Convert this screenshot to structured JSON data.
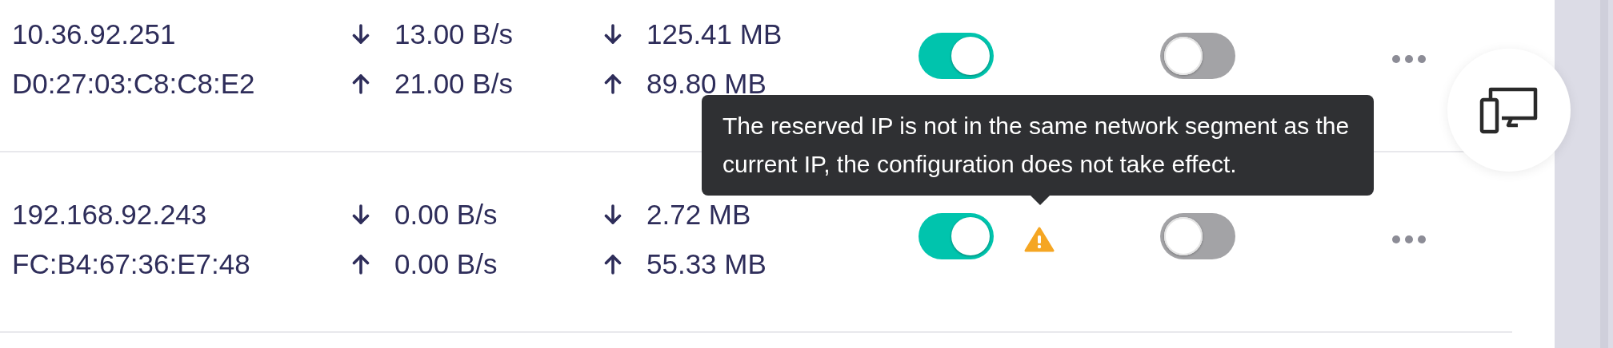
{
  "devices": [
    {
      "ip": "10.36.92.251",
      "mac": "D0:27:03:C8:C8:E2",
      "rate_down": "13.00 B/s",
      "rate_up": "21.00 B/s",
      "total_down": "125.41 MB",
      "total_up": "89.80 MB",
      "switch_1": {
        "on": true
      },
      "warning": false,
      "switch_2": {
        "on": false
      }
    },
    {
      "ip": "192.168.92.243",
      "mac": "FC:B4:67:36:E7:48",
      "rate_down": "0.00 B/s",
      "rate_up": "0.00 B/s",
      "total_down": "2.72 MB",
      "total_up": "55.33 MB",
      "switch_1": {
        "on": true
      },
      "warning": true,
      "switch_2": {
        "on": false
      }
    }
  ],
  "tooltip": {
    "text": "The reserved IP is not in the same network segment as the current IP, the configuration does not take effect."
  }
}
